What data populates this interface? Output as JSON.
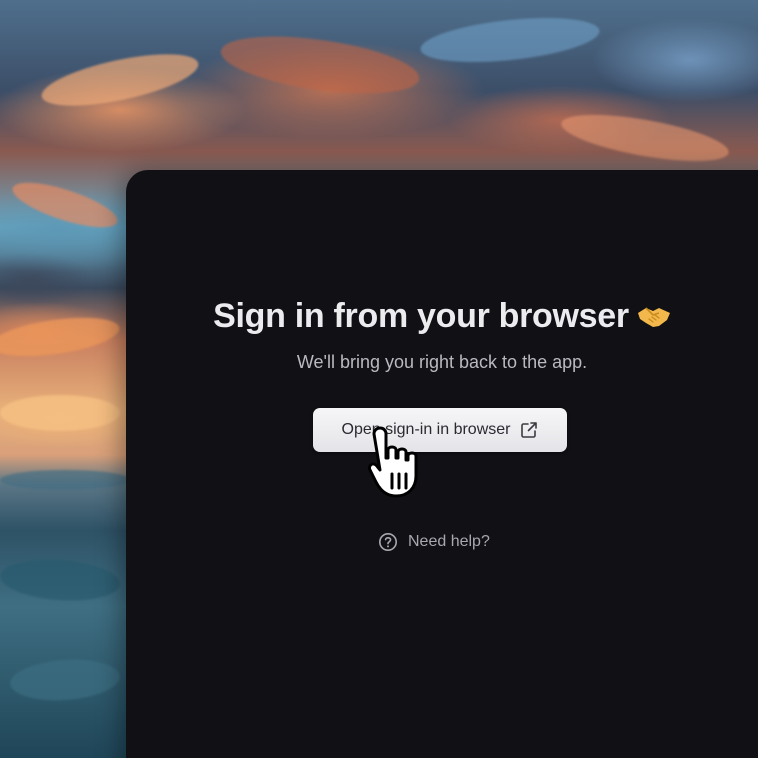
{
  "auth": {
    "title": "Sign in from your browser",
    "subtitle": "We'll bring you right back to the app.",
    "open_button_label": "Open sign-in in browser",
    "help_label": "Need help?"
  },
  "icons": {
    "title_emoji": "handshake-icon",
    "open_button": "external-link-icon",
    "help": "question-circle-icon",
    "cursor": "hand-pointer-cursor-icon"
  },
  "colors": {
    "window_bg": "#111015",
    "title_text": "#ececef",
    "subtitle_text": "#b9b9c0",
    "button_bg": "#f0f0f3",
    "button_text": "#2a2a30",
    "emoji": "#f2b84b"
  }
}
